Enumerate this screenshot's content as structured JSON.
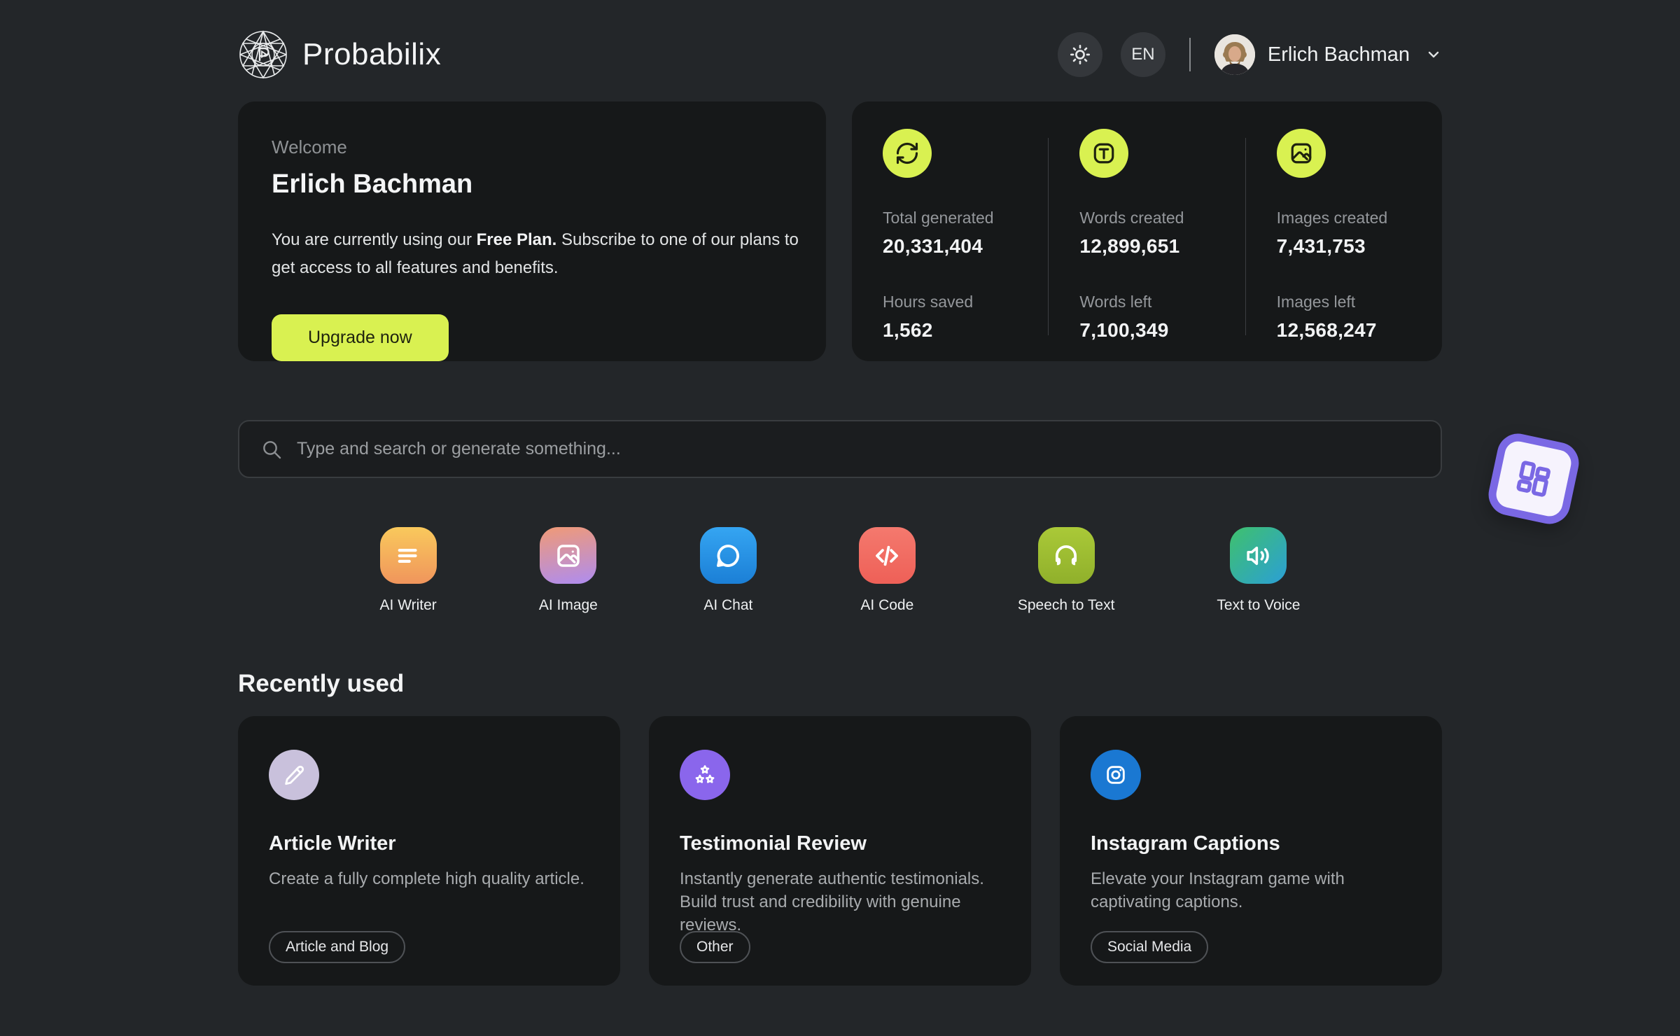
{
  "header": {
    "brand": "Probabilix",
    "language": "EN",
    "user_name": "Erlich Bachman"
  },
  "welcome": {
    "label": "Welcome",
    "name": "Erlich Bachman",
    "body_prefix": "You are currently using our ",
    "plan": "Free Plan.",
    "body_suffix": " Subscribe to one of our plans to get access to all features and benefits.",
    "cta": "Upgrade now"
  },
  "stats": {
    "columns": [
      {
        "icon": "refresh-icon",
        "top_label": "Total generated",
        "top_value": "20,331,404",
        "bottom_label": "Hours saved",
        "bottom_value": "1,562"
      },
      {
        "icon": "text-icon",
        "top_label": "Words created",
        "top_value": "12,899,651",
        "bottom_label": "Words left",
        "bottom_value": "7,100,349"
      },
      {
        "icon": "image-icon",
        "top_label": "Images created",
        "top_value": "7,431,753",
        "bottom_label": "Images left",
        "bottom_value": "12,568,247"
      }
    ]
  },
  "search": {
    "placeholder": "Type and search or generate something..."
  },
  "tools": [
    {
      "label": "AI Writer",
      "icon": "text-lines-icon"
    },
    {
      "label": "AI Image",
      "icon": "picture-icon"
    },
    {
      "label": "AI Chat",
      "icon": "chat-bubble-icon"
    },
    {
      "label": "AI Code",
      "icon": "code-icon"
    },
    {
      "label": "Speech to Text",
      "icon": "headphones-icon"
    },
    {
      "label": "Text to Voice",
      "icon": "speaker-icon"
    }
  ],
  "recent": {
    "heading": "Recently used",
    "cards": [
      {
        "title": "Article Writer",
        "description": "Create a fully complete high quality article.",
        "tag": "Article and Blog",
        "icon": "pencil-icon"
      },
      {
        "title": "Testimonial Review",
        "description": "Instantly generate authentic testimonials. Build trust and credibility with genuine reviews.",
        "tag": "Other",
        "icon": "stars-icon"
      },
      {
        "title": "Instagram Captions",
        "description": "Elevate your Instagram game with captivating captions.",
        "tag": "Social Media",
        "icon": "instagram-icon"
      }
    ]
  },
  "colors": {
    "accent_lime": "#d9f151",
    "accent_purple": "#7a68e4",
    "page_bg": "#232629",
    "card_bg": "#161819",
    "gradient_writer": [
      "#f9c95c",
      "#f0955c"
    ],
    "gradient_image": [
      "#f09a76",
      "#ae8cf0"
    ],
    "gradient_chat": [
      "#35a5f2",
      "#1b7fd6"
    ],
    "gradient_code": [
      "#f4796e",
      "#ee6057"
    ],
    "gradient_speech": [
      "#aac938",
      "#90b02b"
    ],
    "gradient_voice": [
      "#3fc16c",
      "#2b9fd6"
    ],
    "circle_article": "#c9c1dc",
    "circle_testimonial": "#8a66ec",
    "circle_instagram": "#1a78d2"
  }
}
